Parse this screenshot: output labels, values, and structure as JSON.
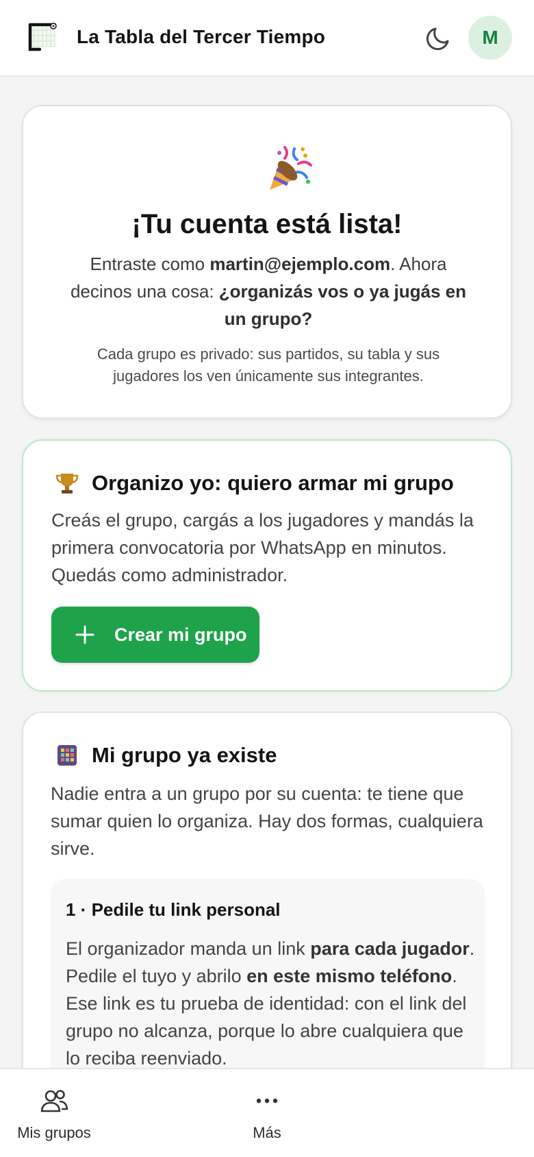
{
  "header": {
    "title": "La Tabla del Tercer Tiempo",
    "avatar_initial": "M",
    "logo_icon": "goal-net-icon",
    "theme_icon": "moon-icon"
  },
  "welcome": {
    "icon": "party-popper-icon",
    "title": "¡Tu cuenta está lista!",
    "text_prefix": "Entraste como ",
    "email": "martin@ejemplo.com",
    "text_middle": ". Ahora decinos una cosa: ",
    "question": "¿organizás vos o ya jugás en un grupo?",
    "note": "Cada grupo es privado: sus partidos, su tabla y sus jugadores los ven únicamente sus integrantes."
  },
  "organize": {
    "icon": "trophy-icon",
    "title": "Organizo yo: quiero armar mi grupo",
    "text": "Creás el grupo, cargás a los jugadores y mandás la primera convocatoria por WhatsApp en minutos. Quedás como administrador.",
    "button_label": "Crear mi grupo"
  },
  "exists": {
    "icon": "abacus-icon",
    "title": "Mi grupo ya existe",
    "text": "Nadie entra a un grupo por su cuenta: te tiene que sumar quien lo organiza. Hay dos formas, cualquiera sirve.",
    "step1": {
      "title": "1 · Pedile tu link personal",
      "t1": "El organizador manda un link ",
      "b1": "para cada jugador",
      "t2": ". Pedile el tuyo y abrilo ",
      "b2": "en este mismo teléfono",
      "t3": ". Ese link es tu prueba de identidad: con el link del grupo no alcanza, porque lo abre cualquiera que lo reciba reenviado."
    }
  },
  "bottom_nav": {
    "groups_label": "Mis grupos",
    "more_label": "Más"
  },
  "colors": {
    "accent": "#1ea34b",
    "avatar_bg": "#dcf0e2",
    "avatar_text": "#17803d"
  }
}
